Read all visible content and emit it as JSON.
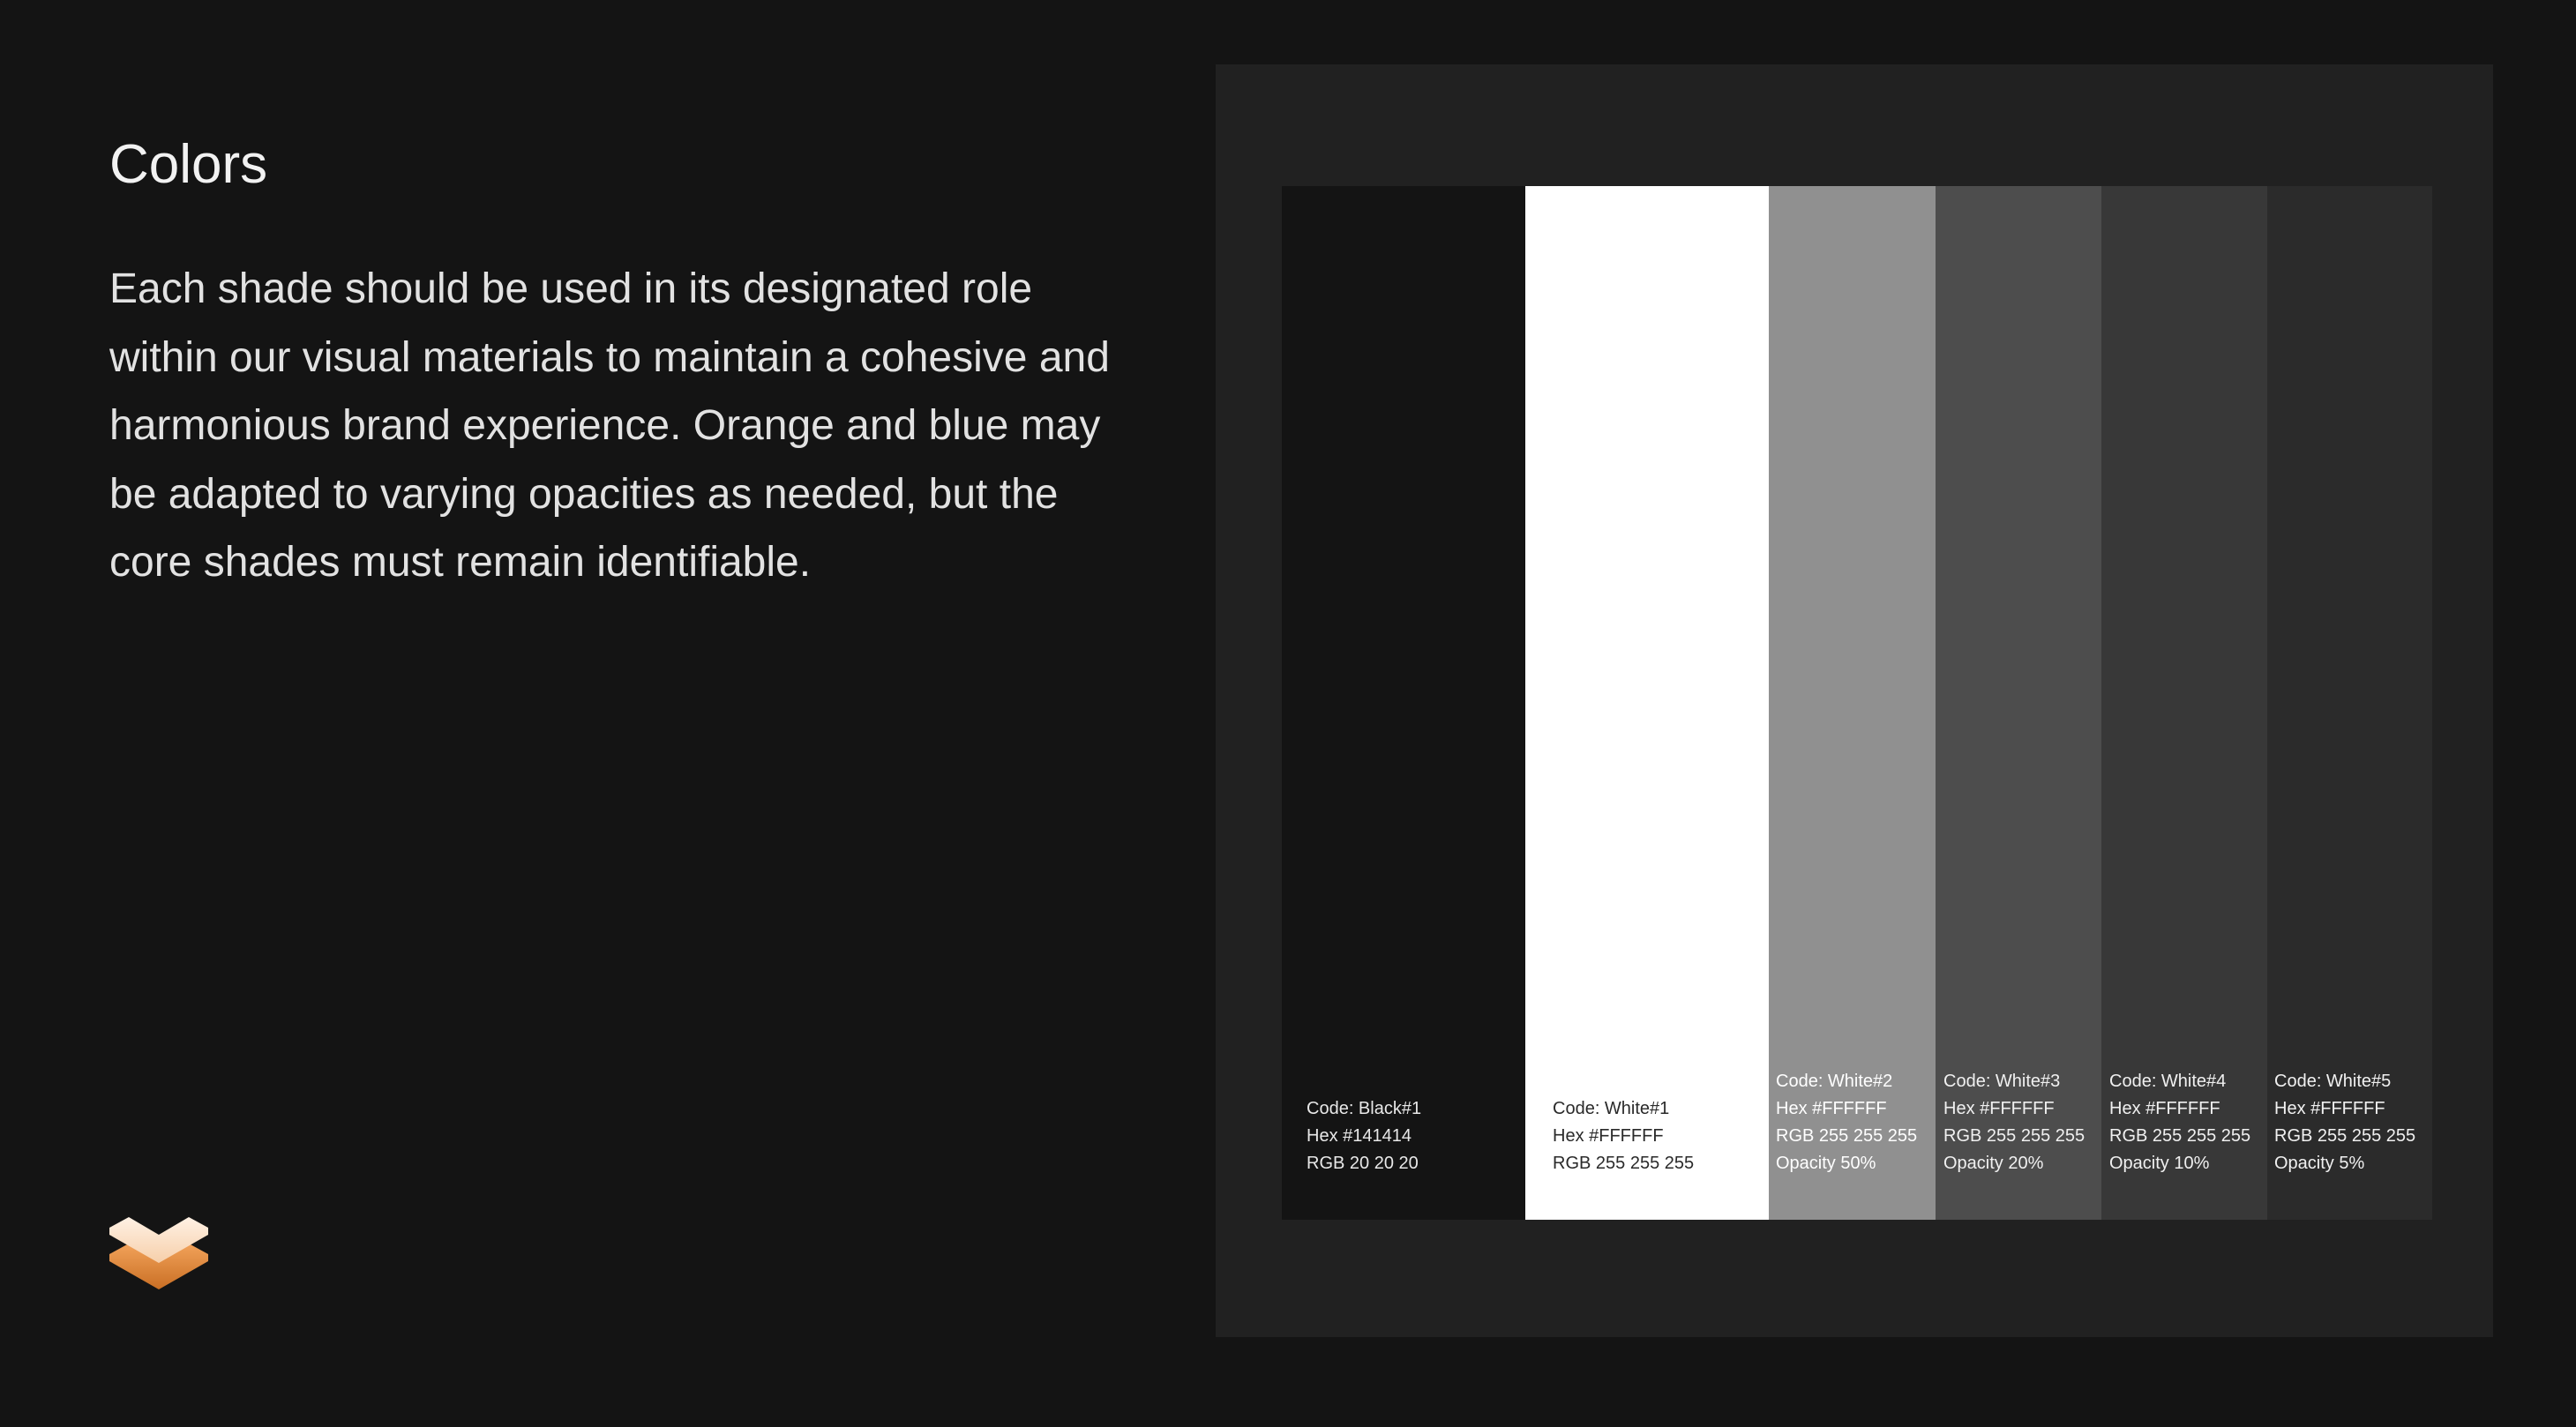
{
  "slide": {
    "title": "Colors",
    "body": "Each shade should be used in its designated role within our visual materials to maintain a cohesive and harmonious brand experience. Orange and blue may be adapted to varying opacities as needed, but the core shades must remain identifiable."
  },
  "logo": {
    "icon": "layered-chevron-logo-icon",
    "colors": [
      "#FCE3CC",
      "#E08A3C"
    ]
  },
  "swatches": [
    {
      "code": "Code: Black#1",
      "hex": "Hex #141414",
      "rgb": "RGB 20 20 20",
      "opacity": "",
      "fill": "#141414",
      "text_color": "#e8e8e8"
    },
    {
      "code": "Code: White#1",
      "hex": "Hex #FFFFFF",
      "rgb": "RGB 255 255 255",
      "opacity": "",
      "fill": "#FFFFFF",
      "text_color": "#2a2a2a"
    },
    {
      "code": "Code: White#2",
      "hex": "Hex #FFFFFF",
      "rgb": "RGB 255 255 255",
      "opacity": "Opacity 50%",
      "fill": "#909090",
      "text_color": "#ffffff"
    },
    {
      "code": "Code: White#3",
      "hex": "Hex #FFFFFF",
      "rgb": "RGB 255 255 255",
      "opacity": "Opacity 20%",
      "fill": "#4d4d4d",
      "text_color": "#f0f0f0"
    },
    {
      "code": "Code: White#4",
      "hex": "Hex #FFFFFF",
      "rgb": "RGB 255 255 255",
      "opacity": "Opacity 10%",
      "fill": "#383838",
      "text_color": "#f0f0f0"
    },
    {
      "code": "Code: White#5",
      "hex": "Hex #FFFFFF",
      "rgb": "RGB 255 255 255",
      "opacity": "Opacity 5%",
      "fill": "#2b2b2b",
      "text_color": "#f0f0f0"
    }
  ]
}
